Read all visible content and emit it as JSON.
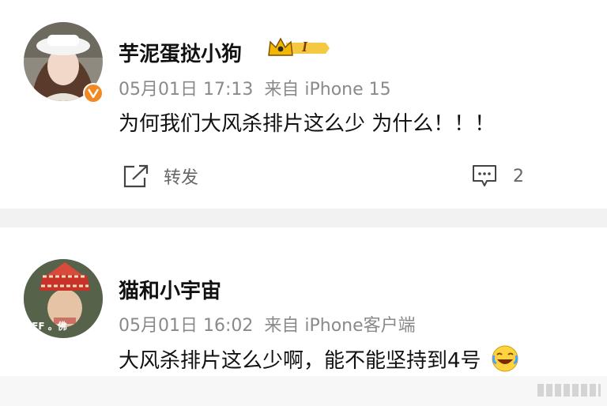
{
  "posts": [
    {
      "username": "芋泥蛋挞小狗",
      "level_badge": "I",
      "date": "05月01日 17:13",
      "source": "来自 iPhone 15",
      "content": "为何我们大风杀排片这么少 为什么！！！",
      "repost_label": "转发",
      "comment_count": "2"
    },
    {
      "username": "猫和小宇宙",
      "date": "05月01日 16:02",
      "source": "来自 iPhone客户端",
      "content": "大风杀排片这么少啊，能不能坚持到4号",
      "avatar_caption": "EFF 。佛"
    }
  ],
  "colors": {
    "verified_badge": "#f08a24",
    "crown_gold": "#f2b705",
    "meta_gray": "#8a8a8a",
    "divider": "#f2f2f2"
  }
}
